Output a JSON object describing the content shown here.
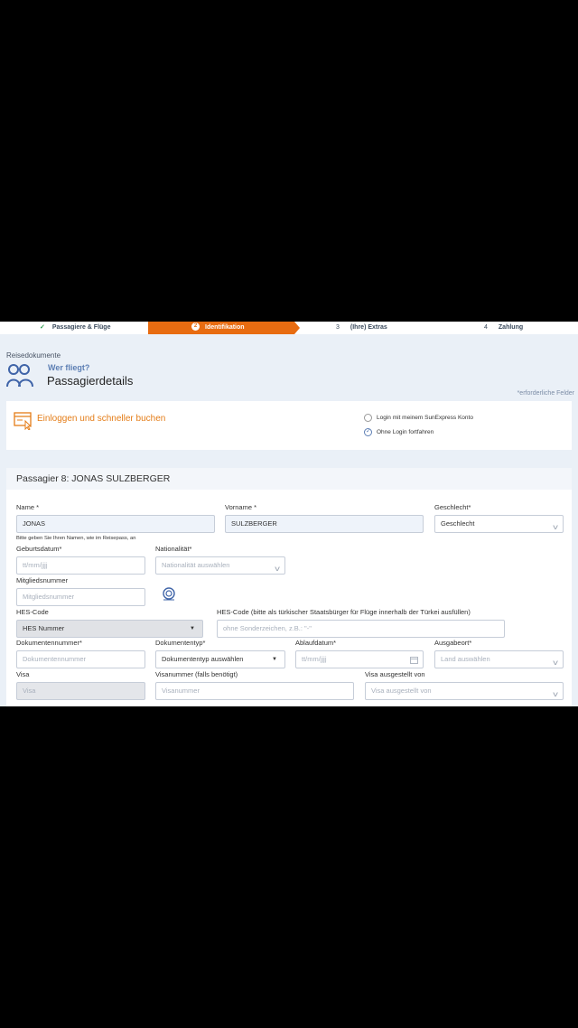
{
  "steps": [
    {
      "check": "✓",
      "label": "Passagiere & Flüge"
    },
    {
      "num": "2",
      "label": "Identifikation"
    },
    {
      "num": "3",
      "label": "(Ihre) Extras"
    },
    {
      "num": "4",
      "label": "Zahlung"
    }
  ],
  "breadcrumb": "Reisedokumente",
  "header": {
    "who": "Wer fliegt?",
    "title": "Passagierdetails",
    "required_note": "*erforderliche Felder"
  },
  "login": {
    "text": "Einloggen und schneller buchen",
    "options": [
      {
        "label": "Login mit meinem SunExpress Konto",
        "selected": false
      },
      {
        "label": "Ohne Login fortfahren",
        "selected": true
      }
    ]
  },
  "passenger": {
    "title": "Passagier 8: JONAS SULZBERGER",
    "fields": {
      "name": {
        "label": "Name *",
        "value": "JONAS"
      },
      "vorname": {
        "label": "Vorname *",
        "value": "SULZBERGER"
      },
      "geschlecht": {
        "label": "Geschlecht*",
        "value": "Geschlecht"
      },
      "name_hint": "Bitte geben Sie Ihren Namen, wie im Reisepass, an",
      "geburtsdatum": {
        "label": "Geburtsdatum*",
        "placeholder": "tt/mm/jjjj"
      },
      "nationalitaet": {
        "label": "Nationalität*",
        "placeholder": "Nationalität auswählen"
      },
      "mitglied": {
        "label": "Mitgliedsnummer",
        "placeholder": "Mitgliedsnummer"
      },
      "hes_code": {
        "label": "HES-Code",
        "value": "HES Nummer"
      },
      "hes_code_text": {
        "label": "HES-Code (bitte als türkischer Staatsbürger für Flüge innerhalb der Türkei ausfüllen)",
        "placeholder": "ohne Sonderzeichen, z.B.: \"-\""
      },
      "dokumentennummer": {
        "label": "Dokumentennummer*",
        "placeholder": "Dokumentennummer"
      },
      "dokumententyp": {
        "label": "Dokumententyp*",
        "value": "Dokumententyp auswählen"
      },
      "ablaufdatum": {
        "label": "Ablaufdatum*",
        "placeholder": "tt/mm/jjjj"
      },
      "ausgabeort": {
        "label": "Ausgabeort*",
        "placeholder": "Land auswählen"
      },
      "visa": {
        "label": "Visa",
        "value": "Visa"
      },
      "visanummer": {
        "label": "Visanummer (falls benötigt)",
        "placeholder": "Visanummer"
      },
      "visa_von": {
        "label": "Visa ausgestellt von",
        "placeholder": "Visa ausgestellt von"
      }
    }
  },
  "colors": {
    "accent": "#e86c11",
    "brand_blue": "#5d7fb4",
    "background": "#eaf0f7"
  },
  "icons": [
    "check-icon",
    "passengers-icon",
    "login-window-icon",
    "chevron-down-icon",
    "calendar-icon",
    "member-card-icon"
  ]
}
